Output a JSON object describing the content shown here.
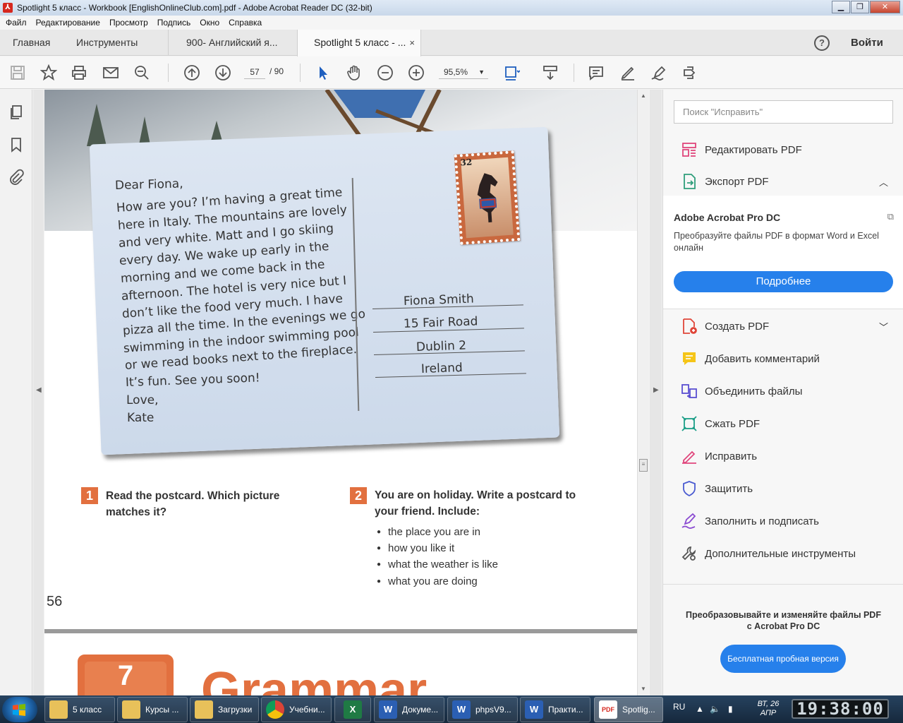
{
  "window": {
    "title": "Spotlight 5 класс - Workbook [EnglishOnlineClub.com].pdf - Adobe Acrobat Reader DC (32-bit)",
    "app_icon": "acrobat-icon"
  },
  "menu": [
    "Файл",
    "Редактирование",
    "Просмотр",
    "Подпись",
    "Окно",
    "Справка"
  ],
  "tabs": {
    "home": "Главная",
    "tools": "Инструменты",
    "doc1": "900- Английский я...",
    "doc2": "Spotlight 5 класс - ...",
    "close": "×",
    "help": "?",
    "login": "Войти"
  },
  "toolbar": {
    "page_current": "57",
    "page_total": "/ 90",
    "zoom": "95,5%",
    "icons": [
      "save-icon",
      "star-icon",
      "print-icon",
      "email-icon",
      "search-zoom-icon",
      "page-up-icon",
      "page-down-icon",
      "select-arrow-icon",
      "hand-icon",
      "zoom-out-icon",
      "zoom-in-icon",
      "fit-page-icon",
      "scroll-mode-icon",
      "comment-icon",
      "highlight-icon",
      "sign-icon",
      "share-icon"
    ]
  },
  "leftnav": [
    "pages-icon",
    "bookmark-icon",
    "attachment-icon"
  ],
  "document": {
    "postcard": {
      "greeting": "Dear Fiona,",
      "body_lines": [
        "How are you? I’m having a great time",
        "here in Italy. The mountains are lovely",
        "and very white. Matt and I go skiing",
        "every day. We wake up early in the",
        "morning and we come back in the",
        "afternoon. The hotel is very nice but I",
        "don’t like the food very much. I have",
        "pizza all the time. In the evenings we go",
        "swimming in the indoor swimming pool",
        "or we read books next to the fireplace.",
        "It’s fun. See you soon!"
      ],
      "closing": "Love,",
      "signature": "Kate",
      "stamp_value": "32",
      "address": [
        "Fiona Smith",
        "15 Fair Road",
        "Dublin 2",
        "Ireland"
      ]
    },
    "exercise1": {
      "number": "1",
      "line1": "Read the postcard. Which picture",
      "line2": "matches it?"
    },
    "exercise2": {
      "number": "2",
      "line1": "You are on holiday. Write a postcard to",
      "line2": "your friend. Include:",
      "bullets": [
        "the place you are in",
        "how you like it",
        "what the weather is like",
        "what you are doing"
      ]
    },
    "page_number": "56",
    "next_page": {
      "unit_number": "7",
      "heading": "Grammar"
    }
  },
  "rightpanel": {
    "search_placeholder": "Поиск \"Исправить\"",
    "items_top": [
      {
        "label": "Редактировать PDF",
        "icon": "edit-pdf-icon"
      },
      {
        "label": "Экспорт PDF",
        "icon": "export-pdf-icon"
      }
    ],
    "promo": {
      "title": "Adobe Acrobat Pro DC",
      "desc": "Преобразуйте файлы PDF в формат Word и Excel онлайн",
      "button": "Подробнее"
    },
    "items": [
      {
        "label": "Создать PDF",
        "icon": "create-pdf-icon"
      },
      {
        "label": "Добавить комментарий",
        "icon": "comment-icon"
      },
      {
        "label": "Объединить файлы",
        "icon": "combine-icon"
      },
      {
        "label": "Сжать PDF",
        "icon": "compress-icon"
      },
      {
        "label": "Исправить",
        "icon": "fix-icon"
      },
      {
        "label": "Защитить",
        "icon": "protect-icon"
      },
      {
        "label": "Заполнить и подписать",
        "icon": "fill-sign-icon"
      },
      {
        "label": "Дополнительные инструменты",
        "icon": "more-tools-icon"
      }
    ],
    "bottom_text_1": "Преобразовывайте и изменяйте файлы PDF",
    "bottom_text_2": "с Acrobat Pro DC",
    "trial_button": "Бесплатная пробная версия",
    "colors": {
      "accent": "#2680eb"
    }
  },
  "taskbar": {
    "buttons": [
      {
        "label": "5 класс",
        "icon": "folder-icon"
      },
      {
        "label": "Курсы ...",
        "icon": "folder-icon"
      },
      {
        "label": "Загрузки",
        "icon": "folder-icon"
      },
      {
        "label": "Учебни...",
        "icon": "chrome-icon"
      },
      {
        "label": "",
        "icon": "excel-icon"
      },
      {
        "label": "Докуме...",
        "icon": "word-icon"
      },
      {
        "label": "phpsV9...",
        "icon": "word-icon"
      },
      {
        "label": "Практи...",
        "icon": "word-icon"
      },
      {
        "label": "Spotlig...",
        "icon": "acrobat-icon"
      }
    ],
    "lang": "RU",
    "date_day": "ВТ, 26",
    "date_month": "АПР",
    "time": "19:38:00"
  }
}
